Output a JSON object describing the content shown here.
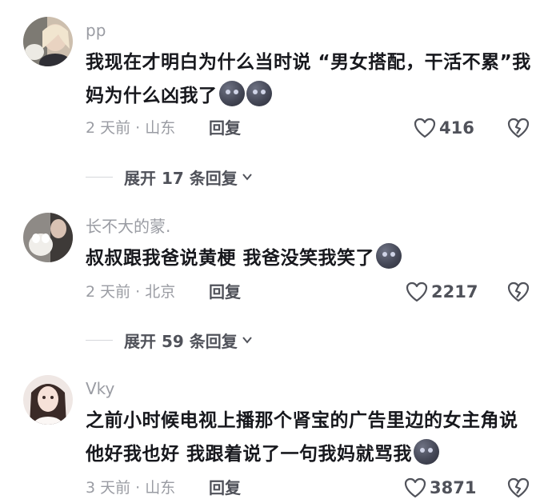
{
  "comments": [
    {
      "username": "pp",
      "text": "我现在才明白为什么当时说 “男女搭配，干活不累”我妈为什么凶我了",
      "emoji_count": 2,
      "time_location": "2 天前 · 山东",
      "reply_label": "回复",
      "likes": "416",
      "expand_label": "展开 17 条回复",
      "avatar_icon": "user-avatar-photo"
    },
    {
      "username": "长不大的蒙.",
      "text": "叔叔跟我爸说黄梗 我爸没笑我笑了",
      "emoji_count": 1,
      "time_location": "2 天前 · 北京",
      "reply_label": "回复",
      "likes": "2217",
      "expand_label": "展开 59 条回复",
      "avatar_icon": "user-avatar-photo"
    },
    {
      "username": "Vky",
      "text": "之前小时候电视上播那个肾宝的广告里边的女主角说他好我也好 我跟着说了一句我妈就骂我",
      "emoji_count": 1,
      "time_location": "3 天前 · 山东",
      "reply_label": "回复",
      "likes": "3871",
      "avatar_icon": "user-avatar-photo"
    }
  ],
  "icons": {
    "like": "heart-outline-icon",
    "dislike": "broken-heart-icon",
    "emoji": "dark-face-emoji",
    "expand": "chevron-down-icon"
  },
  "colors": {
    "text": "#17181d",
    "muted": "#9a9ca3",
    "action": "#50525a"
  }
}
